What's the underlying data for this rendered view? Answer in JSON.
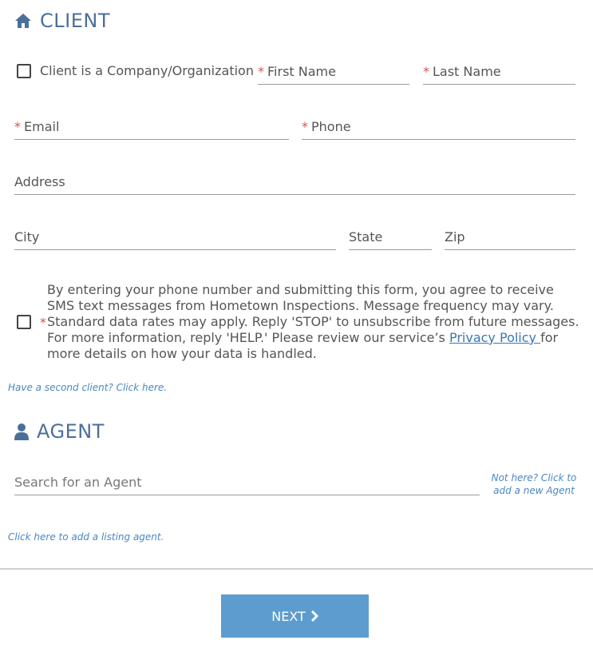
{
  "client_section": {
    "title": "CLIENT",
    "icon": "home-icon",
    "company_checkbox_label": "Client is a Company/Organization",
    "first_name_label": "First Name",
    "last_name_label": "Last Name",
    "email_label": "Email",
    "phone_label": "Phone",
    "address_label": "Address",
    "city_label": "City",
    "state_label": "State",
    "zip_label": "Zip",
    "required_marker": "*",
    "consent_text_before": "By entering your phone number and submitting this form, you agree to receive SMS text messages from Hometown Inspections. Message frequency may vary. Standard data rates may apply. Reply 'STOP' to unsubscribe from future messages. For more information, reply 'HELP.' Please review our service’s ",
    "consent_link": "Privacy Policy ",
    "consent_text_after": "for more details on how your data is handled.",
    "second_client_link": "Have a second client? Click here."
  },
  "agent_section": {
    "title": "AGENT",
    "icon": "user-icon",
    "search_placeholder": "Search for an Agent",
    "add_agent_link": "Not here? Click to add a new Agent",
    "listing_agent_link": "Click here to add a listing agent."
  },
  "footer": {
    "next_label": "NEXT",
    "next_icon": "chevron-right-icon"
  },
  "colors": {
    "section_title": "#4b6f9a",
    "required": "#d9534f",
    "link": "#4a87c4",
    "button": "#5d9ccf"
  }
}
